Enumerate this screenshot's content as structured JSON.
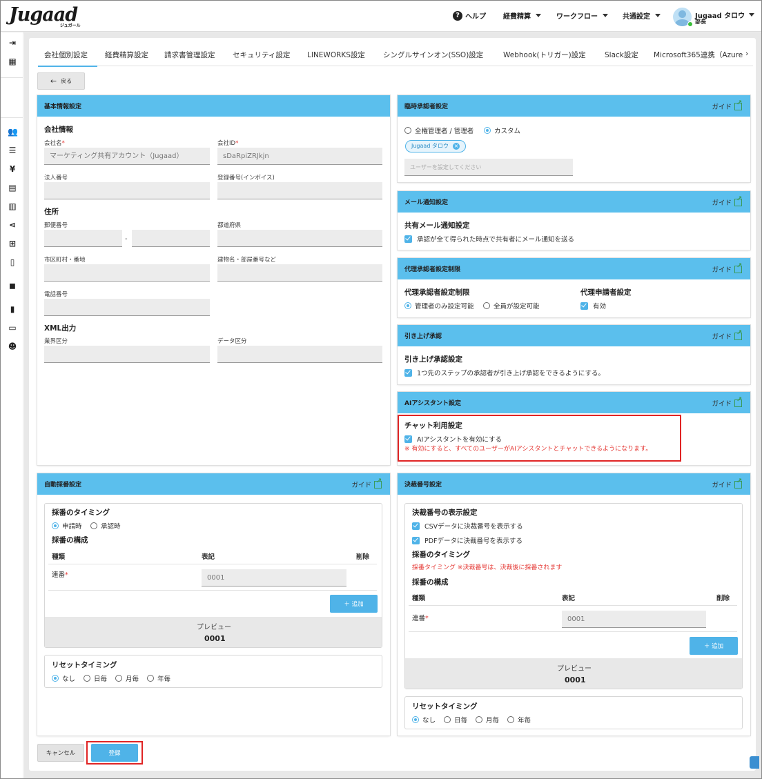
{
  "header": {
    "logo": "Jugaad",
    "logo_sub": "ジュガール",
    "help": "ヘルプ",
    "menu_expense": "経費精算",
    "menu_workflow": "ワークフロー",
    "menu_common": "共通設定",
    "user_name": "Jugaad タロウ",
    "user_role": "部長"
  },
  "tabs": [
    "会社個別設定",
    "経費精算設定",
    "請求書管理設定",
    "セキュリティ設定",
    "LINEWORKS設定",
    "シングルサインオン(SSO)設定",
    "Webhook(トリガー)設定",
    "Slack設定",
    "Microsoft365連携（Azure"
  ],
  "tab_more": "›",
  "back_label": "戻る",
  "guide_label": "ガイド",
  "basic": {
    "title": "基本情報設定",
    "company_info": "会社情報",
    "company_name_label": "会社名",
    "company_name_value": "マーケティング共有アカウント（Jugaad）",
    "company_id_label": "会社ID",
    "company_id_value": "sDaRpiZRJkjn",
    "corp_number_label": "法人番号",
    "reg_number_label": "登録番号(インボイス)",
    "address": "住所",
    "postal_label": "郵便番号",
    "postal_sep": "-",
    "prefecture_label": "都道府県",
    "city_label": "市区町村・番地",
    "building_label": "建物名・部屋番号など",
    "phone_label": "電話番号",
    "xml_title": "XML出力",
    "industry_label": "業界区分",
    "data_label": "データ区分",
    "required_mark": "*"
  },
  "temp_approver": {
    "title": "臨時承認者設定",
    "opt_admin": "全権管理者 / 管理者",
    "opt_custom": "カスタム",
    "chip": "Jugaad タロウ",
    "chip_x": "×",
    "placeholder": "ユーザーを設定してください"
  },
  "mail": {
    "title": "メール通知設定",
    "subtitle": "共有メール通知設定",
    "check": "承認が全て得られた時点で共有者にメール通知を送る"
  },
  "proxy": {
    "title": "代理承認者設定制限",
    "subtitle": "代理承認者設定制限",
    "opt_admin_only": "管理者のみ設定可能",
    "opt_all": "全員が設定可能",
    "applicant_title": "代理申請者設定",
    "applicant_check": "有効"
  },
  "pullup": {
    "title": "引き上げ承認",
    "subtitle": "引き上げ承認設定",
    "check": "1つ先のステップの承認者が引き上げ承認をできるようにする。"
  },
  "ai": {
    "title": "AIアシスタント設定",
    "subtitle": "チャット利用設定",
    "check": "AIアシスタントを有効にする",
    "note": "※ 有効にすると、すべてのユーザーがAIアシスタントとチャットできるようになります。"
  },
  "auto_number": {
    "title": "自動採番設定",
    "timing_title": "採番のタイミング",
    "opt_apply": "申請時",
    "opt_approve": "承認時",
    "structure_title": "採番の構成",
    "col_type": "種類",
    "col_notation": "表記",
    "col_delete": "削除",
    "row_type": "連番",
    "row_value": "0001",
    "add_label": "＋ 追加",
    "preview_label": "プレビュー",
    "preview_value": "0001",
    "reset_title": "リセットタイミング",
    "reset_options": [
      "なし",
      "日毎",
      "月毎",
      "年毎"
    ]
  },
  "decision_number": {
    "title": "決裁番号設定",
    "display_title": "決裁番号の表示設定",
    "check_csv": "CSVデータに決裁番号を表示する",
    "check_pdf": "PDFデータに決裁番号を表示する",
    "timing_title": "採番のタイミング",
    "timing_note": "採番タイミング ※決裁番号は、決裁後に採番されます",
    "structure_title": "採番の構成",
    "col_type": "種類",
    "col_notation": "表記",
    "col_delete": "削除",
    "row_type": "連番",
    "row_value": "0001",
    "add_label": "＋ 追加",
    "preview_label": "プレビュー",
    "preview_value": "0001",
    "reset_title": "リセットタイミング",
    "reset_options": [
      "なし",
      "日毎",
      "月毎",
      "年毎"
    ]
  },
  "footer": {
    "cancel": "キャンセル",
    "submit": "登録"
  },
  "colors": {
    "accent": "#4fb3e8",
    "panel_header": "#5bbfed",
    "highlight": "#e02424"
  }
}
